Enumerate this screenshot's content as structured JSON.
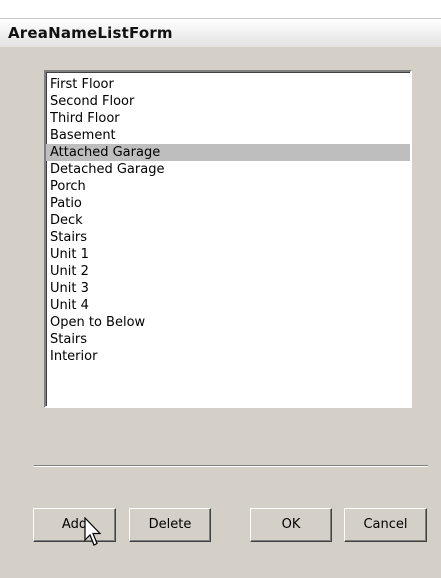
{
  "window": {
    "title": "AreaNameListForm"
  },
  "area_list": {
    "selected_index": 4,
    "items": [
      "First Floor",
      "Second Floor",
      "Third Floor",
      "Basement",
      "Attached Garage",
      "Detached Garage",
      "Porch",
      "Patio",
      "Deck",
      "Stairs",
      "Unit 1",
      "Unit 2",
      "Unit 3",
      "Unit 4",
      "Open to Below",
      "Stairs",
      "Interior"
    ]
  },
  "buttons": {
    "add": "Add",
    "delete": "Delete",
    "ok": "OK",
    "cancel": "Cancel"
  },
  "colors": {
    "dialog_face": "#d4d0c8",
    "selection_highlight": "#bebebe",
    "list_background": "#ffffff"
  },
  "icons": {
    "cursor": "arrow-pointer-icon"
  }
}
